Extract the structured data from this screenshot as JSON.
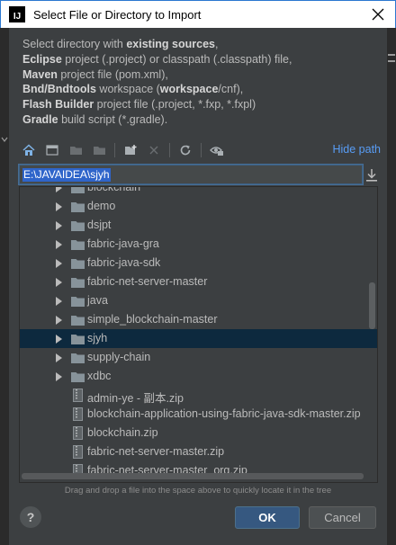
{
  "window": {
    "title": "Select File or Directory to Import",
    "app_icon_letter": "IJ"
  },
  "description": {
    "lines": [
      [
        {
          "t": "Select directory with ",
          "b": false
        },
        {
          "t": "existing sources",
          "b": true
        },
        {
          "t": ",",
          "b": false
        }
      ],
      [
        {
          "t": "Eclipse",
          "b": true
        },
        {
          "t": " project (.project) or classpath (.classpath) file,",
          "b": false
        }
      ],
      [
        {
          "t": "Maven",
          "b": true
        },
        {
          "t": " project file (pom.xml),",
          "b": false
        }
      ],
      [
        {
          "t": "Bnd/Bndtools",
          "b": true
        },
        {
          "t": " workspace (",
          "b": false
        },
        {
          "t": "workspace",
          "b": true
        },
        {
          "t": "/cnf),",
          "b": false
        }
      ],
      [
        {
          "t": "Flash Builder",
          "b": true
        },
        {
          "t": " project file (.project, *.fxp, *.fxpl)",
          "b": false
        }
      ],
      [
        {
          "t": "Gradle",
          "b": true
        },
        {
          "t": " build script (*.gradle).",
          "b": false
        }
      ]
    ]
  },
  "toolbar": {
    "icons": [
      "home-icon",
      "desktop-icon",
      "project-folder-icon",
      "module-folder-icon",
      "new-folder-icon",
      "delete-icon",
      "refresh-icon",
      "show-hidden-icon"
    ],
    "hide_path_label": "Hide path"
  },
  "path_field": {
    "value": "E:\\JAVAIDEA\\sjyh"
  },
  "tree": {
    "items": [
      {
        "label": "blockchain",
        "type": "folder",
        "selected": false
      },
      {
        "label": "demo",
        "type": "folder",
        "selected": false
      },
      {
        "label": "dsjpt",
        "type": "folder",
        "selected": false
      },
      {
        "label": "fabric-java-gra",
        "type": "folder",
        "selected": false
      },
      {
        "label": "fabric-java-sdk",
        "type": "folder",
        "selected": false
      },
      {
        "label": "fabric-net-server-master",
        "type": "folder",
        "selected": false
      },
      {
        "label": "java",
        "type": "folder",
        "selected": false
      },
      {
        "label": "simple_blockchain-master",
        "type": "folder",
        "selected": false
      },
      {
        "label": "sjyh",
        "type": "folder",
        "selected": true
      },
      {
        "label": "supply-chain",
        "type": "folder",
        "selected": false
      },
      {
        "label": "xdbc",
        "type": "folder",
        "selected": false
      },
      {
        "label": "admin-ye - 副本.zip",
        "type": "file",
        "selected": false
      },
      {
        "label": "blockchain-application-using-fabric-java-sdk-master.zip",
        "type": "file",
        "selected": false
      },
      {
        "label": "blockchain.zip",
        "type": "file",
        "selected": false
      },
      {
        "label": "fabric-net-server-master.zip",
        "type": "file",
        "selected": false
      },
      {
        "label": "fabric-net-server-master_org.zip",
        "type": "file",
        "selected": false
      }
    ]
  },
  "hint": "Drag and drop a file into the space above to quickly locate it in the tree",
  "buttons": {
    "help_label": "?",
    "ok_label": "OK",
    "cancel_label": "Cancel"
  },
  "colors": {
    "dialog_bg": "#3c3f41",
    "selection": "#0d293e",
    "link": "#589df6",
    "ok_button": "#365880",
    "folder": "#87939a"
  }
}
